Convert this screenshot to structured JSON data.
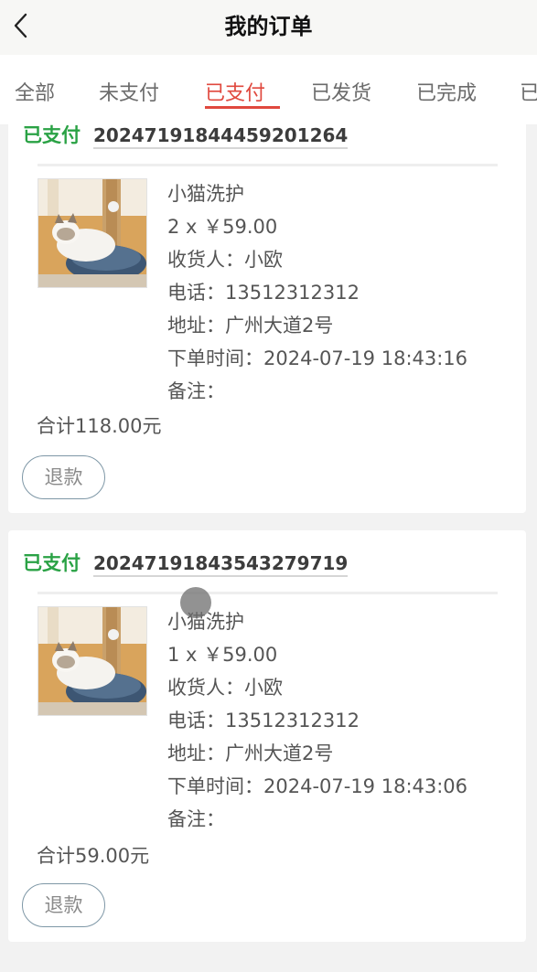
{
  "header": {
    "title": "我的订单"
  },
  "tabs": [
    {
      "label": "全部"
    },
    {
      "label": "未支付"
    },
    {
      "label": "已支付"
    },
    {
      "label": "已发货"
    },
    {
      "label": "已完成"
    },
    {
      "label": "已"
    }
  ],
  "active_tab": "已支付",
  "colors": {
    "accent": "#e0483e",
    "status_green": "#2aa245"
  },
  "orders": [
    {
      "status": "已支付",
      "order_no": "20247191844459201264",
      "product_name": "小猫洗护",
      "qty_price": "2 x ￥59.00",
      "receiver": "收货人：小欧",
      "phone": "电话：13512312312",
      "address": "地址：广州大道2号",
      "order_time": "下单时间：2024-07-19 18:43:16",
      "remark": "备注：",
      "total": "合计118.00元",
      "action_label": "退款"
    },
    {
      "status": "已支付",
      "order_no": "20247191843543279719",
      "product_name": "小猫洗护",
      "qty_price": "1 x ￥59.00",
      "receiver": "收货人：小欧",
      "phone": "电话：13512312312",
      "address": "地址：广州大道2号",
      "order_time": "下单时间：2024-07-19 18:43:06",
      "remark": "备注：",
      "total": "合计59.00元",
      "action_label": "退款"
    }
  ]
}
